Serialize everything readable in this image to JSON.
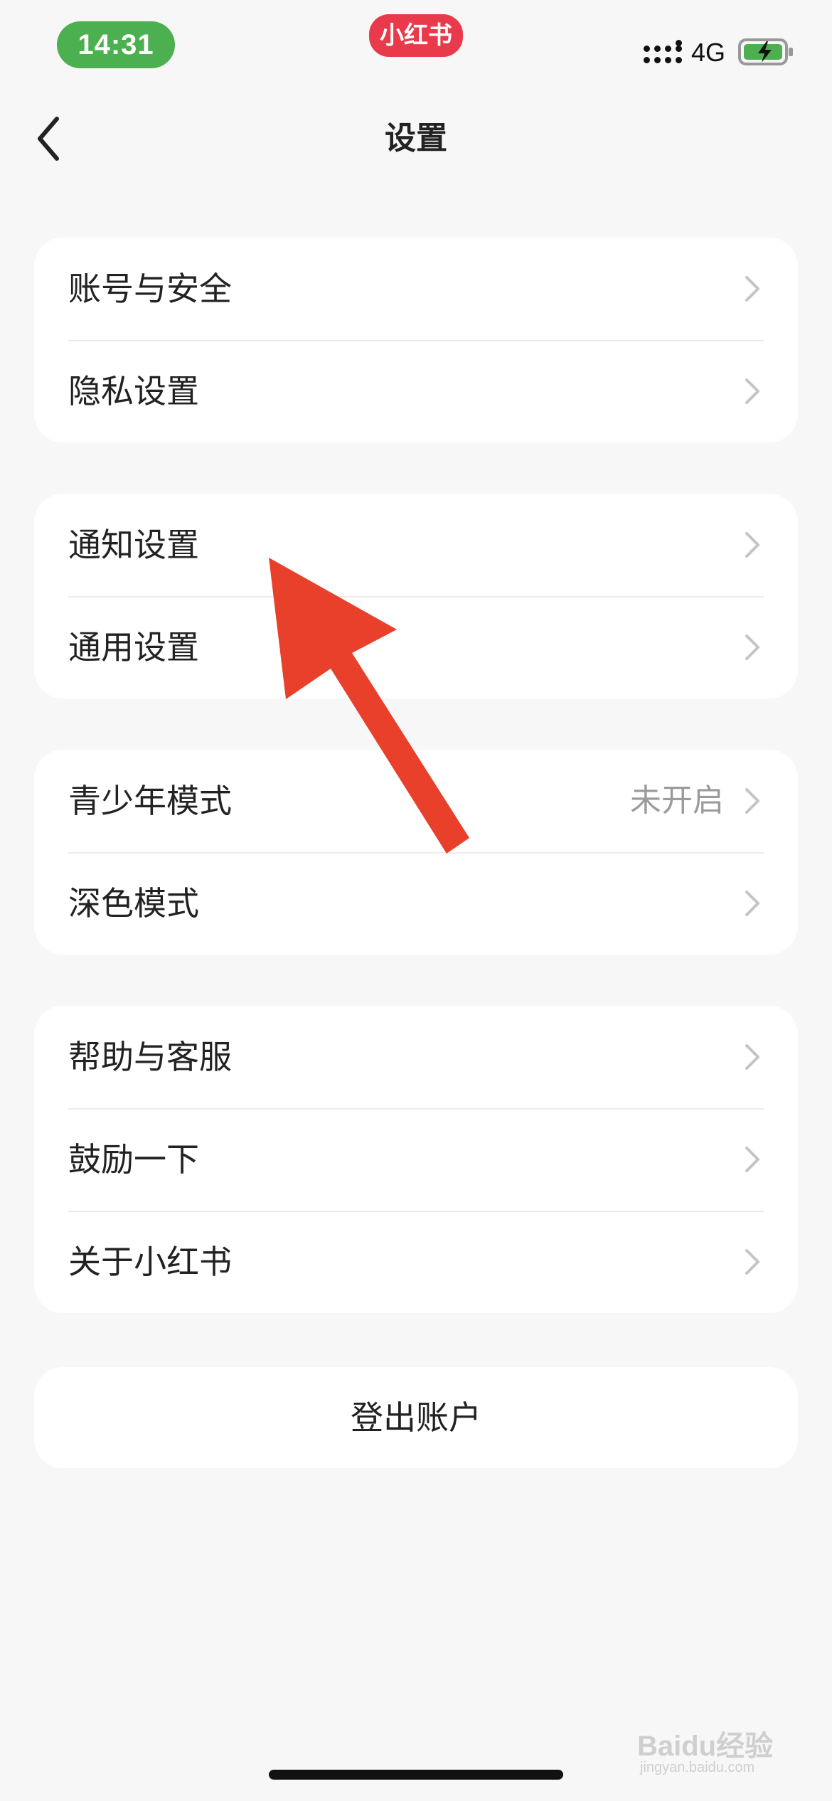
{
  "status_bar": {
    "time": "14:31",
    "brand": "小红书",
    "network": "4G",
    "signal_icon": "signal-icon",
    "battery_icon": "battery-charging-icon"
  },
  "header": {
    "back_icon": "chevron-left-icon",
    "title": "设置"
  },
  "groups": [
    {
      "items": [
        {
          "label": "账号与安全"
        },
        {
          "label": "隐私设置"
        }
      ]
    },
    {
      "items": [
        {
          "label": "通知设置"
        },
        {
          "label": "通用设置"
        }
      ]
    },
    {
      "items": [
        {
          "label": "青少年模式",
          "value": "未开启"
        },
        {
          "label": "深色模式"
        }
      ]
    },
    {
      "items": [
        {
          "label": "帮助与客服"
        },
        {
          "label": "鼓励一下"
        },
        {
          "label": "关于小红书"
        }
      ]
    }
  ],
  "logout": {
    "label": "登出账户"
  },
  "watermark": {
    "text": "Baidu经验",
    "sub": "jingyan.baidu.com"
  },
  "colors": {
    "background": "#f7f7f7",
    "card": "#ffffff",
    "time_pill": "#4caf50",
    "brand_badge": "#e83a4b",
    "arrow": "#e8402b",
    "secondary_text": "#9b9b9b"
  }
}
